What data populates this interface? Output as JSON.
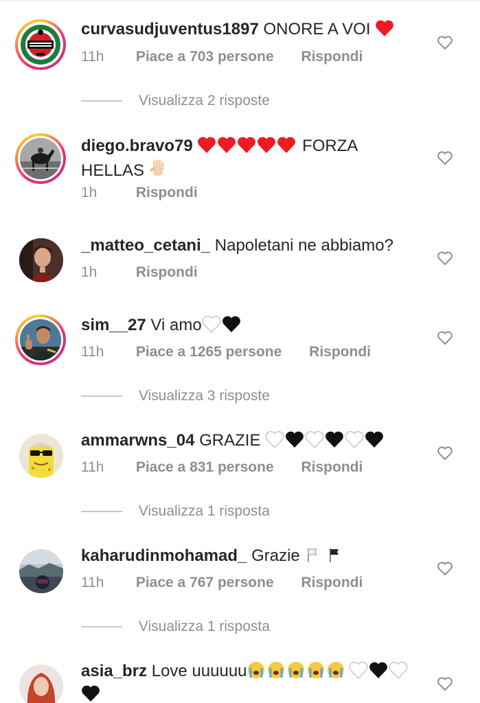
{
  "comments": [
    {
      "username": "curvasudjuventus1897",
      "text": "ONORE A VOI",
      "emoji": "❤️",
      "time": "11h",
      "likes": "Piace a 703 persone",
      "reply": "Rispondi",
      "view_replies": "Visualizza 2 risposte",
      "avatar_icon": "curva-sud-juventus-logo"
    },
    {
      "username": "diego.bravo79",
      "text": "FORZA HELLAS",
      "emoji": "❤️❤️❤️❤️❤️",
      "time": "1h",
      "reply": "Rispondi",
      "avatar_icon": "horse-photo"
    },
    {
      "username": "_matteo_cetani_",
      "text": "Napoletani ne abbiamo?",
      "time": "1h",
      "reply": "Rispondi",
      "avatar_icon": "person-photo"
    },
    {
      "username": "sim__27",
      "text": "Vi amo",
      "emoji": "🤍🖤",
      "time": "11h",
      "likes": "Piace a 1265 persone",
      "reply": "Rispondi",
      "view_replies": "Visualizza 3 risposte",
      "avatar_icon": "player-thumbs-up-photo"
    },
    {
      "username": "ammarwns_04",
      "text": "GRAZIE",
      "emoji": "🤍🖤🤍🖤🤍🖤",
      "time": "11h",
      "likes": "Piace a 831 persone",
      "reply": "Rispondi",
      "view_replies": "Visualizza 1 risposta",
      "avatar_icon": "spongebob-avatar"
    },
    {
      "username": "kaharudinmohamad_",
      "text": "Grazie",
      "emoji": "🏳️🏴",
      "time": "11h",
      "likes": "Piace a 767 persone",
      "reply": "Rispondi",
      "view_replies": "Visualizza 1 risposta",
      "avatar_icon": "landscape-photo"
    },
    {
      "username": "asia_brz",
      "text": "Love uuuuuu",
      "emoji": "😭😭😭😭😭🤍🖤🤍🖤",
      "avatar_icon": "girl-red-hair-photo"
    }
  ],
  "colors": {
    "text": "#262626",
    "secondary": "#8e8e8e",
    "heart_red": "#ed1c24",
    "black_heart": "#111111"
  }
}
